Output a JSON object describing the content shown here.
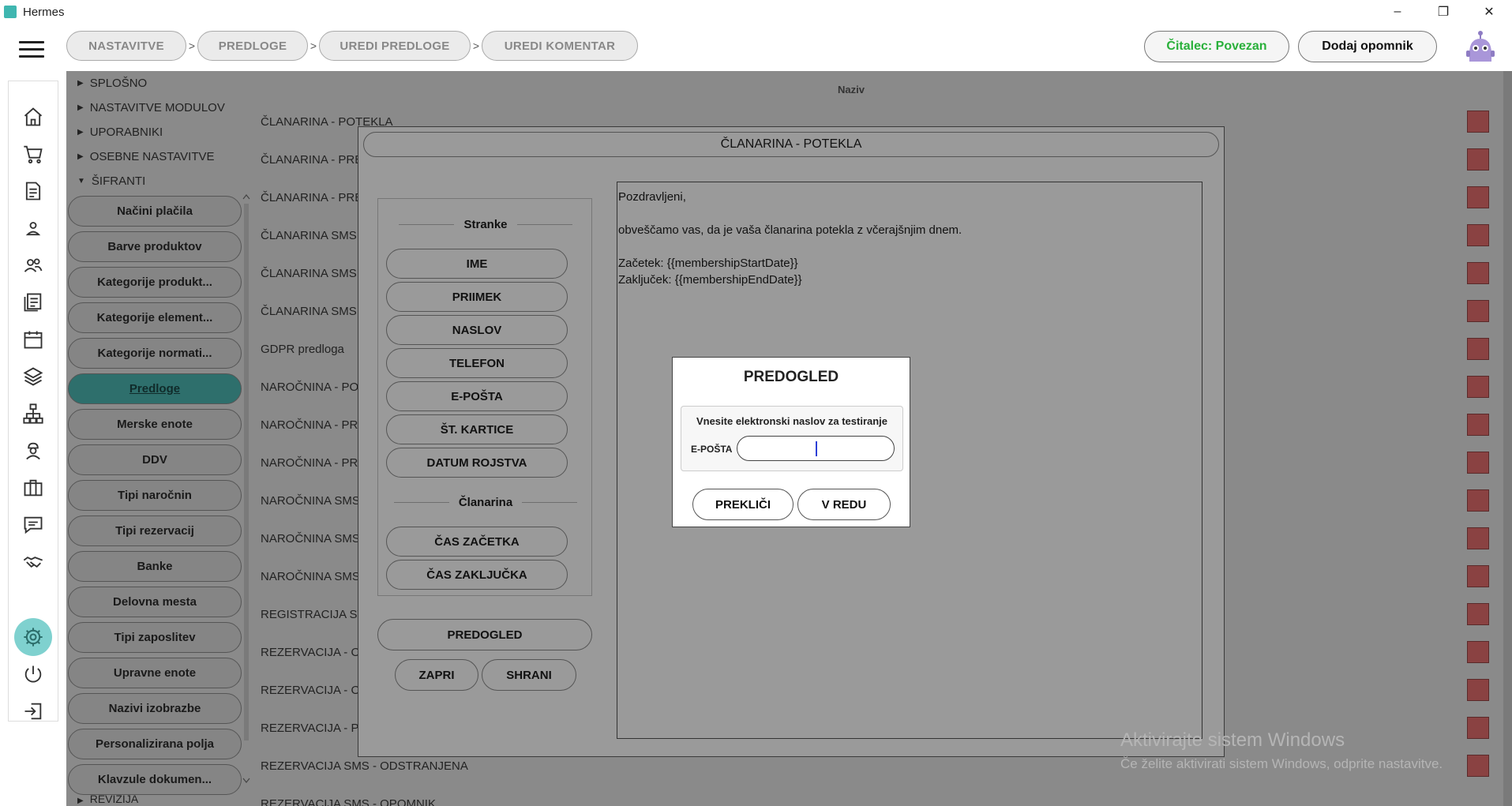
{
  "window": {
    "title": "Hermes",
    "minimize": "–",
    "restore": "❐",
    "close": "✕"
  },
  "header": {
    "breadcrumbs": [
      "NASTAVITVE",
      "PREDLOGE",
      "UREDI PREDLOGE",
      "UREDI KOMENTAR"
    ],
    "separator": ">",
    "reader_status": "Čitalec: Povezan",
    "add_reminder": "Dodaj opomnik",
    "colors": {
      "reader_status": "#29b03a",
      "accent": "#3fb6b0"
    }
  },
  "rail": {
    "icons": [
      "home-icon",
      "cart-icon",
      "document-icon",
      "user-icon",
      "users-icon",
      "list-icon",
      "calendar-icon",
      "layers-icon",
      "hierarchy-icon",
      "worker-icon",
      "briefcase-icon",
      "chat-icon",
      "handshake-icon",
      "gear-icon",
      "power-icon",
      "logout-icon"
    ],
    "active": "gear-icon"
  },
  "tree": {
    "sections": [
      {
        "label": "SPLOŠNO",
        "expanded": false
      },
      {
        "label": "NASTAVITVE MODULOV",
        "expanded": false
      },
      {
        "label": "UPORABNIKI",
        "expanded": false
      },
      {
        "label": "OSEBNE NASTAVITVE",
        "expanded": false
      },
      {
        "label": "ŠIFRANTI",
        "expanded": true
      }
    ],
    "items": [
      "Načini plačila",
      "Barve produktov",
      "Kategorije produkt...",
      "Kategorije element...",
      "Kategorije normati...",
      "Predloge",
      "Merske enote",
      "DDV",
      "Tipi naročnin",
      "Tipi rezervacij",
      "Banke",
      "Delovna mesta",
      "Tipi zaposlitev",
      "Upravne enote",
      "Nazivi izobrazbe",
      "Personalizirana polja",
      "Klavzule dokumen..."
    ],
    "active_item": "Predloge",
    "bottom_section": "REVIZIJA"
  },
  "table": {
    "column_header": "Naziv",
    "rows": [
      "ČLANARINA - POTEKLA",
      "ČLANARINA - PRE",
      "ČLANARINA - PRE",
      "ČLANARINA SMS -",
      "ČLANARINA SMS -",
      "ČLANARINA SMS -",
      "GDPR predloga",
      "NAROČNINA - PO",
      "NAROČNINA - PRE",
      "NAROČNINA - PRE",
      "NAROČNINA SMS",
      "NAROČNINA SMS",
      "NAROČNINA SMS",
      "REGISTRACIJA STR",
      "REZERVACIJA - OD",
      "REZERVACIJA - OP",
      "REZERVACIJA - PR",
      "REZERVACIJA SMS - ODSTRANJENA",
      "REZERVACIJA SMS - OPOMNIK"
    ]
  },
  "editor_modal": {
    "title": "ČLANARINA - POTEKLA",
    "groups": [
      {
        "label": "Stranke",
        "buttons": [
          "IME",
          "PRIIMEK",
          "NASLOV",
          "TELEFON",
          "E-POŠTA",
          "ŠT. KARTICE",
          "DATUM ROJSTVA"
        ]
      },
      {
        "label": "Članarina",
        "buttons": [
          "ČAS ZAČETKA",
          "ČAS ZAKLJUČKA"
        ]
      }
    ],
    "preview_button": "PREDOGLED",
    "close_button": "ZAPRI",
    "save_button": "SHRANI",
    "body_lines": [
      "Pozdravljeni,",
      "",
      "obveščamo vas, da je vaša članarina potekla z včerajšnjim dnem.",
      "",
      "Začetek: {{membershipStartDate}}",
      "Zaključek: {{membershipEndDate}}"
    ]
  },
  "preview_dialog": {
    "title": "PREDOGLED",
    "note": "Vnesite elektronski naslov za testiranje",
    "email_label": "E-POŠTA",
    "email_value": "",
    "cancel_button": "PREKLIČI",
    "ok_button": "V REDU"
  },
  "watermark": {
    "line1": "Aktivirajte sistem Windows",
    "line2": "Če želite aktivirati sistem Windows, odprite nastavitve."
  }
}
